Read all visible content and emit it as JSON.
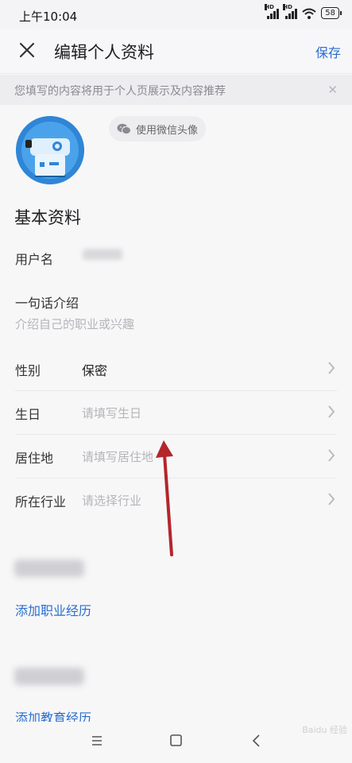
{
  "status_bar": {
    "time": "上午10:04",
    "battery": "58",
    "network_label": "HD"
  },
  "header": {
    "title": "编辑个人资料",
    "save_label": "保存"
  },
  "notice": {
    "text": "您填写的内容将用于个人页展示及内容推荐",
    "close_glyph": "✕"
  },
  "avatar": {
    "wechat_button_label": "使用微信头像"
  },
  "basic_section": {
    "title": "基本资料",
    "username_label": "用户名",
    "intro_label": "一句话介绍",
    "intro_placeholder": "介绍自己的职业或兴趣"
  },
  "fields": [
    {
      "label": "性别",
      "value": "保密",
      "placeholder": ""
    },
    {
      "label": "生日",
      "value": "",
      "placeholder": "请填写生日"
    },
    {
      "label": "居住地",
      "value": "",
      "placeholder": "请填写居住地"
    },
    {
      "label": "所在行业",
      "value": "",
      "placeholder": "请选择行业"
    }
  ],
  "career": {
    "add_label": "添加职业经历"
  },
  "education": {
    "add_label": "添加教育经历"
  },
  "watermark": "Baidu 经验",
  "colors": {
    "accent": "#2a6ecf",
    "annotation_arrow": "#b3262a",
    "avatar_bg": "#2f86d6"
  }
}
